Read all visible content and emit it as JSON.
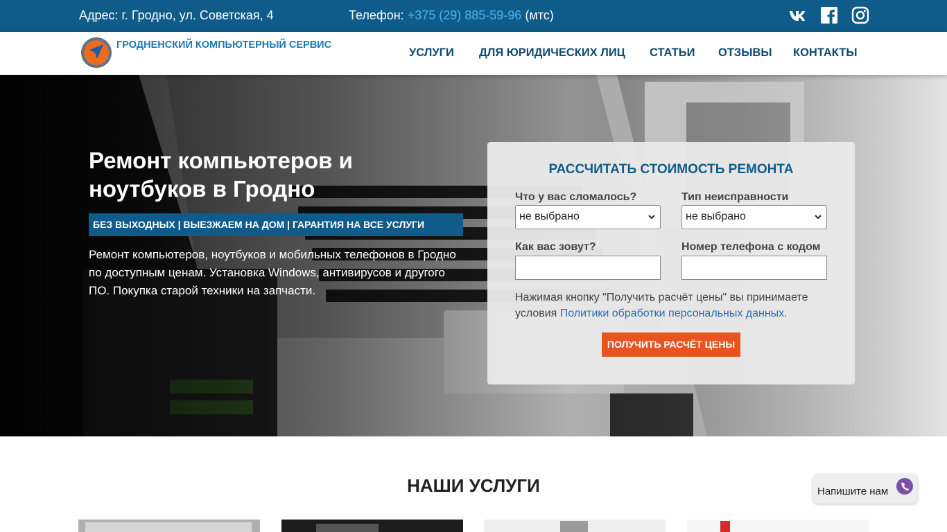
{
  "topbar": {
    "address": "Адрес: г. Гродно, ул. Советская, 4",
    "phone_label": "Телефон:",
    "phone_number": "+375 (29) 885-59-96",
    "phone_operator": "(мтс)",
    "social_icons": [
      "vk-icon",
      "facebook-icon",
      "instagram-icon"
    ]
  },
  "header": {
    "logo_text": "ГРОДНЕНСКИЙ КОМПЬЮТЕРНЫЙ СЕРВИС",
    "nav": [
      "УСЛУГИ",
      "ДЛЯ ЮРИДИЧЕСКИХ ЛИЦ",
      "СТАТЬИ",
      "ОТЗЫВЫ",
      "КОНТАКТЫ"
    ]
  },
  "hero": {
    "title": "Ремонт компьютеров и ноутбуков в Гродно",
    "tagline": "БЕЗ ВЫХОДНЫХ | ВЫЕЗЖАЕМ НА ДОМ | ГАРАНТИЯ НА ВСЕ УСЛУГИ",
    "description": "Ремонт компьютеров, ноутбуков и мобильных телефонов в Гродно по доступным ценам. Установка Windows, антивирусов и другого ПО. Покупка старой техники на запчасти."
  },
  "form": {
    "title": "РАССЧИТАТЬ СТОИМОСТЬ РЕМОНТА",
    "broken_label": "Что у вас сломалось?",
    "broken_value": "не выбрано",
    "fault_label": "Тип неисправности",
    "fault_value": "не выбрано",
    "name_label": "Как вас зовут?",
    "name_value": "",
    "phone_label": "Номер телефона с кодом",
    "phone_value": "",
    "note_text": "Нажимая кнопку \"Получить расчёт цены\" вы принимаете условия",
    "note_link": "Политики обработки персональных данных.",
    "submit_label": "ПОЛУЧИТЬ РАСЧЁТ ЦЕНЫ"
  },
  "services": {
    "title": "НАШИ УСЛУГИ"
  },
  "chat": {
    "label": "Напишите нам",
    "icon": "viber-icon"
  },
  "colors": {
    "brand_blue": "#0f5c8a",
    "accent_orange": "#e8531f",
    "link_blue": "#2b6cb0",
    "phone_highlight": "#4fb3f0"
  }
}
